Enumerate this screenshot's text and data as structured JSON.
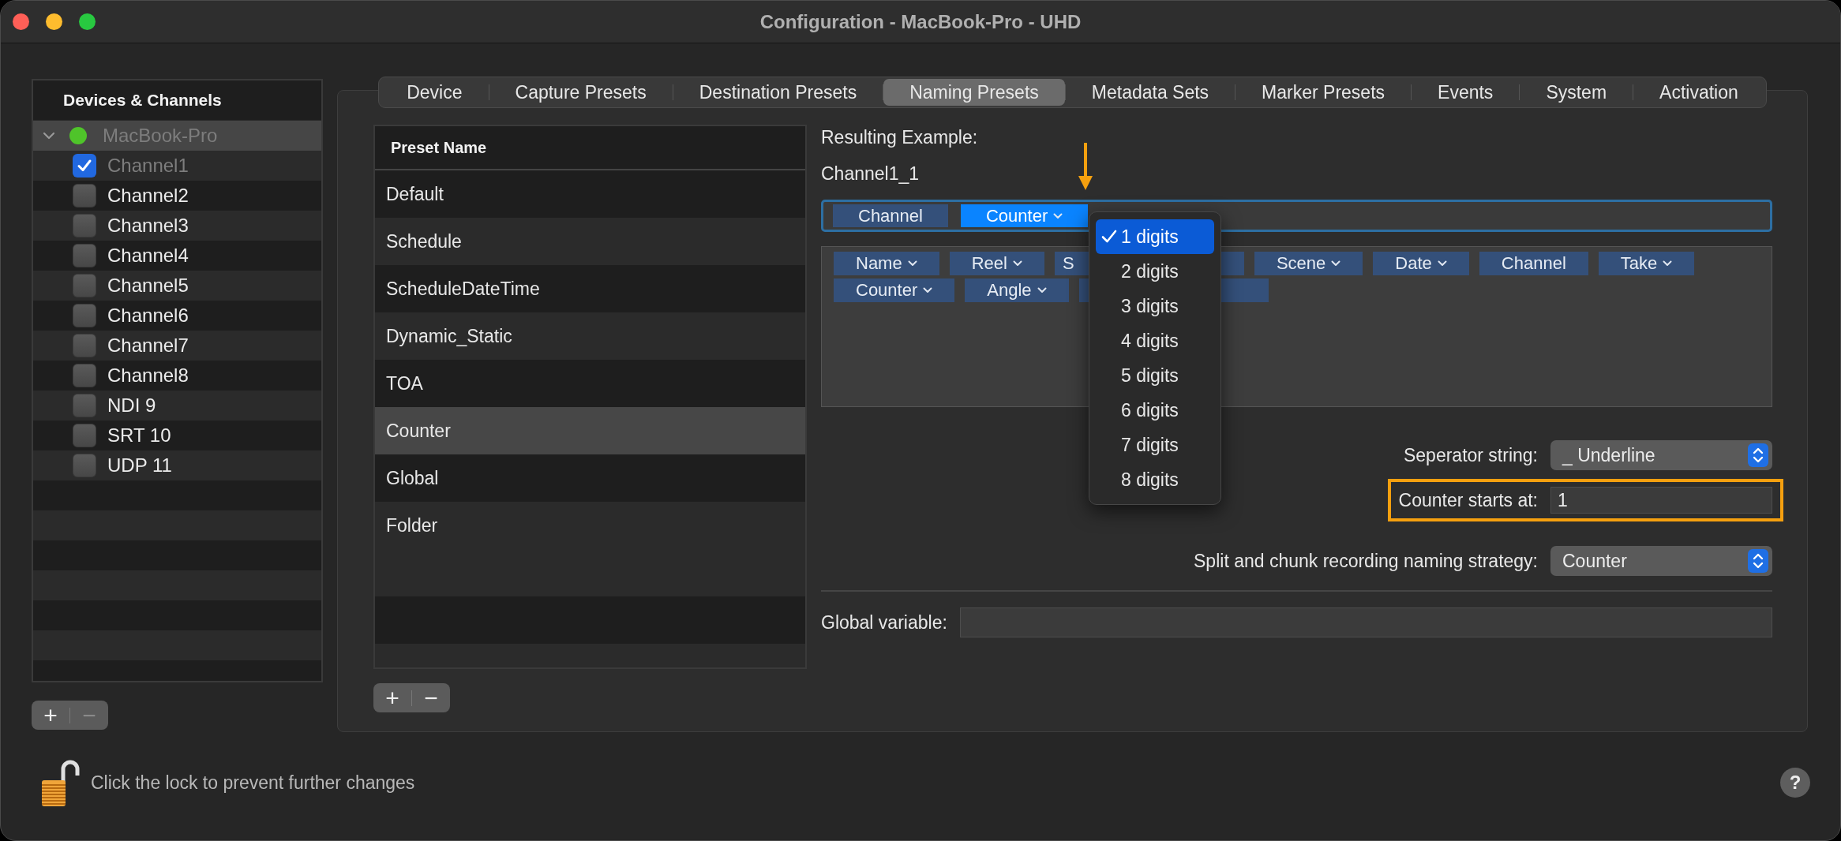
{
  "window": {
    "title": "Configuration - MacBook-Pro - UHD"
  },
  "sidebar": {
    "header": "Devices & Channels",
    "device": {
      "name": "MacBook-Pro",
      "expanded": true,
      "disabled": true
    },
    "channels": [
      {
        "name": "Channel1",
        "checked": true,
        "disabled": true
      },
      {
        "name": "Channel2",
        "checked": false,
        "disabled": false
      },
      {
        "name": "Channel3",
        "checked": false,
        "disabled": false
      },
      {
        "name": "Channel4",
        "checked": false,
        "disabled": false
      },
      {
        "name": "Channel5",
        "checked": false,
        "disabled": false
      },
      {
        "name": "Channel6",
        "checked": false,
        "disabled": false
      },
      {
        "name": "Channel7",
        "checked": false,
        "disabled": false
      },
      {
        "name": "Channel8",
        "checked": false,
        "disabled": false
      },
      {
        "name": "NDI 9",
        "checked": false,
        "disabled": false
      },
      {
        "name": "SRT 10",
        "checked": false,
        "disabled": false
      },
      {
        "name": "UDP 11",
        "checked": false,
        "disabled": false
      }
    ],
    "buttons": [
      {
        "label": "+",
        "disabled": false
      },
      {
        "label": "−",
        "disabled": true
      }
    ]
  },
  "tabs": [
    {
      "label": "Device",
      "selected": false
    },
    {
      "label": "Capture Presets",
      "selected": false
    },
    {
      "label": "Destination Presets",
      "selected": false
    },
    {
      "label": "Naming Presets",
      "selected": true
    },
    {
      "label": "Metadata Sets",
      "selected": false
    },
    {
      "label": "Marker Presets",
      "selected": false
    },
    {
      "label": "Events",
      "selected": false
    },
    {
      "label": "System",
      "selected": false
    },
    {
      "label": "Activation",
      "selected": false
    }
  ],
  "presets": {
    "column": "Preset Name",
    "rows": [
      {
        "name": "Default",
        "selected": false
      },
      {
        "name": "Schedule",
        "selected": false
      },
      {
        "name": "ScheduleDateTime",
        "selected": false
      },
      {
        "name": "Dynamic_Static",
        "selected": false
      },
      {
        "name": "TOA",
        "selected": false
      },
      {
        "name": "Counter",
        "selected": true
      },
      {
        "name": "Global",
        "selected": false
      },
      {
        "name": "Folder",
        "selected": false
      }
    ],
    "buttons": [
      {
        "label": "+",
        "disabled": false
      },
      {
        "label": "−",
        "disabled": false
      }
    ]
  },
  "editor": {
    "example_label": "Resulting Example:",
    "example": "Channel1_1",
    "sequence": [
      {
        "label": "Channel",
        "caret": false,
        "selected": false,
        "marked": false
      },
      {
        "label": "Counter",
        "caret": true,
        "selected": true,
        "marked": true
      }
    ],
    "pool": [
      {
        "label": "Name",
        "caret": true
      },
      {
        "label": "Reel",
        "caret": true
      },
      {
        "label": "S",
        "caret": false,
        "covered": true
      },
      {
        "label": "Scene",
        "caret": true
      },
      {
        "label": "Date",
        "caret": true
      },
      {
        "label": "Channel",
        "caret": false
      },
      {
        "label": "Take",
        "caret": true
      },
      {
        "label": "Counter",
        "caret": true
      },
      {
        "label": "Angle",
        "caret": true
      },
      {
        "caret": false,
        "covered": true
      }
    ],
    "menu": [
      {
        "label": "1 digits",
        "selected": true
      },
      {
        "label": "2 digits",
        "selected": false
      },
      {
        "label": "3 digits",
        "selected": false
      },
      {
        "label": "4 digits",
        "selected": false
      },
      {
        "label": "5 digits",
        "selected": false
      },
      {
        "label": "6 digits",
        "selected": false
      },
      {
        "label": "7 digits",
        "selected": false
      },
      {
        "label": "8 digits",
        "selected": false
      }
    ],
    "separator": {
      "label": "Seperator string:",
      "value": "_ Underline"
    },
    "counter_start": {
      "label": "Counter starts at:",
      "value": "1",
      "highlighted": true
    },
    "split": {
      "label": "Split and chunk recording naming strategy:",
      "value": "Counter"
    },
    "global": {
      "label": "Global variable:"
    }
  },
  "footer": {
    "lock_text": "Click the lock to prevent further changes",
    "locked": false,
    "help": "?"
  }
}
